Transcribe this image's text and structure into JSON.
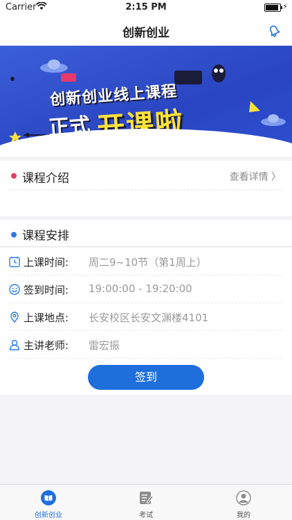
{
  "status": {
    "carrier": "Carrier",
    "time": "2:15 PM"
  },
  "nav": {
    "title": "创新创业"
  },
  "banner": {
    "line1": "创新创业线上课程",
    "line2a": "正式",
    "line2b": "开课啦"
  },
  "intro": {
    "label": "课程介绍",
    "more": "查看详情 〉"
  },
  "schedule": {
    "label": "课程安排",
    "rows": [
      {
        "icon": "clock-icon",
        "key": "上课时间:",
        "value": "周二9~10节（第1周上）"
      },
      {
        "icon": "smile-icon",
        "key": "签到时间:",
        "value": "19:00:00 - 19:20:00"
      },
      {
        "icon": "location-icon",
        "key": "上课地点:",
        "value": "长安校区长安文渊楼4101"
      },
      {
        "icon": "person-icon",
        "key": "主讲老师:",
        "value": "雷宏振"
      }
    ],
    "button": "签到"
  },
  "tabs": [
    {
      "label": "创新创业",
      "icon": "book-icon",
      "active": true
    },
    {
      "label": "考试",
      "icon": "exam-icon",
      "active": false
    },
    {
      "label": "我的",
      "icon": "profile-icon",
      "active": false
    }
  ],
  "colors": {
    "accent": "#1e6fdc",
    "intro_dot": "#e8396a",
    "sched_dot": "#2b7be6"
  }
}
